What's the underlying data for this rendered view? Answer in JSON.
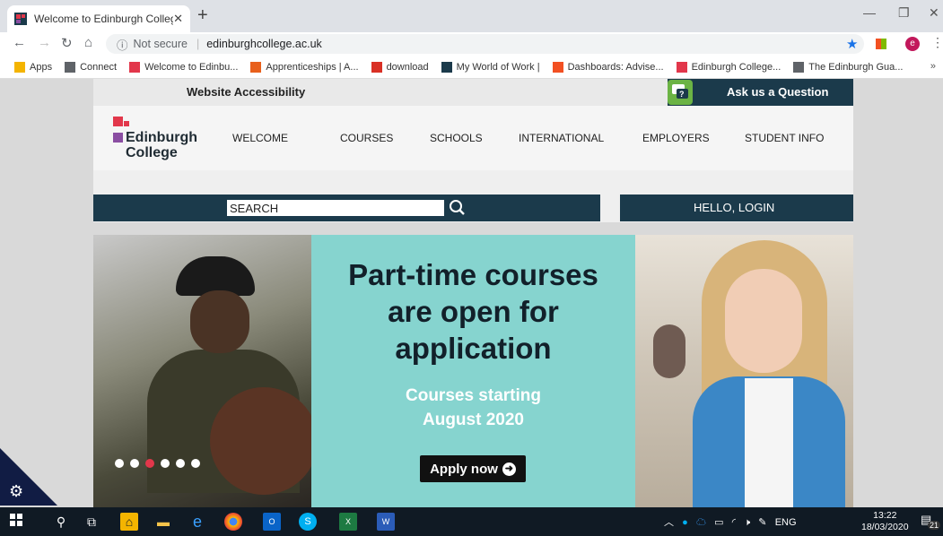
{
  "browser": {
    "tab_title": "Welcome to Edinburgh College",
    "url_security": "Not secure",
    "url": "edinburghcollege.ac.uk",
    "profile_initial": "e",
    "bookmarks": [
      {
        "label": "Apps",
        "icon": "apps-grid-icon",
        "color": "#f4b400"
      },
      {
        "label": "Connect",
        "icon": "connect-icon",
        "color": "#5f6368"
      },
      {
        "label": "Welcome to Edinbu...",
        "icon": "edinburgh-college-icon",
        "color": "#e2374b"
      },
      {
        "label": "Apprenticeships | A...",
        "icon": "apprenticeships-icon",
        "color": "#e8601c"
      },
      {
        "label": "download",
        "icon": "download-icon",
        "color": "#d93025"
      },
      {
        "label": "My World of Work |",
        "icon": "myworldofwork-icon",
        "color": "#1b3a4b"
      },
      {
        "label": "Dashboards: Advise...",
        "icon": "dashboards-icon",
        "color": "#f25022"
      },
      {
        "label": "Edinburgh College...",
        "icon": "edinburgh-college-icon",
        "color": "#e2374b"
      },
      {
        "label": "The Edinburgh Gua...",
        "icon": "globe-icon",
        "color": "#5f6368"
      }
    ]
  },
  "site": {
    "accessibility": "Website Accessibility",
    "ask": "Ask us a Question",
    "logo_line1": "Edinburgh",
    "logo_line2": "College",
    "nav": [
      "WELCOME",
      "COURSES",
      "SCHOOLS",
      "INTERNATIONAL",
      "EMPLOYERS",
      "STUDENT INFO"
    ],
    "search_value": "SEARCH",
    "login": "HELLO, LOGIN"
  },
  "hero": {
    "headline_lines": [
      "Part-time courses",
      "are open for",
      "application"
    ],
    "sub_lines": [
      "Courses starting",
      "August 2020"
    ],
    "apply": "Apply now",
    "slides": 6,
    "active_slide": 3
  },
  "taskbar": {
    "language": "ENG",
    "time": "13:22",
    "date": "18/03/2020",
    "notifications": "21"
  },
  "colors": {
    "brand_dark": "#1b3a4b",
    "brand_red": "#e2374b",
    "brand_purple": "#8a4ea2",
    "hero_teal": "#86d4cf"
  }
}
